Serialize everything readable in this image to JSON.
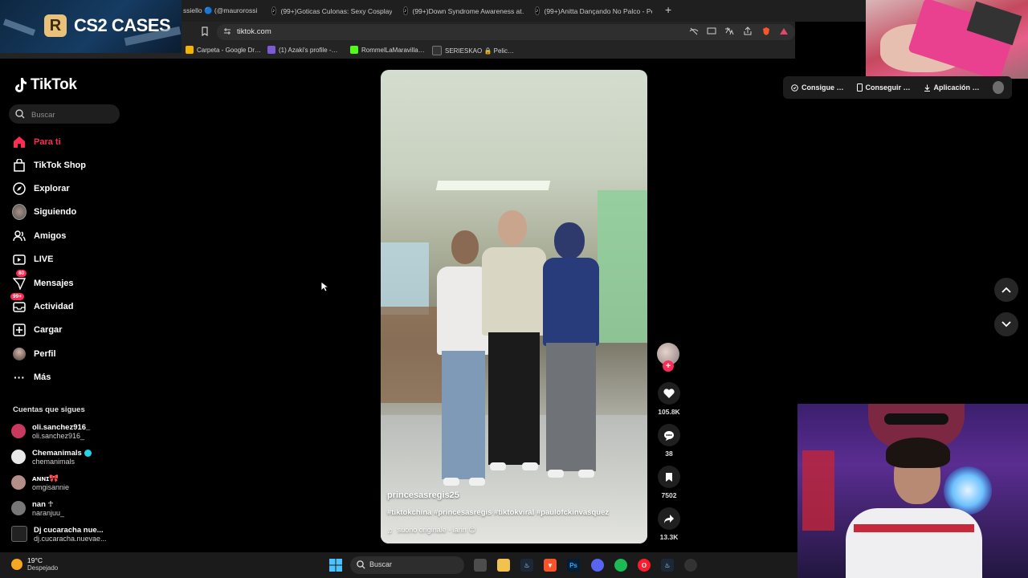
{
  "browser": {
    "tabs": [
      {
        "label": "ssiello 🔵 (@maurorossiell…"
      },
      {
        "label": "(99+)Goticas Culonas: Sexy Cosplay"
      },
      {
        "label": "(99+)Down Syndrome Awareness at…"
      },
      {
        "label": "(99+)Anitta Dançando No Palco - Pe"
      }
    ],
    "new_tab": "+",
    "url": "tiktok.com",
    "bookmarks": [
      {
        "label": "Carpeta - Google Dr…",
        "color": "#f4b400"
      },
      {
        "label": "(1) Azaki's profile -…",
        "color": "#7b5cd6"
      },
      {
        "label": "RommelLaMaravilla…",
        "color": "#53fc18"
      },
      {
        "label": "SERIESKAO 🔒 Pelic…",
        "color": "#333333"
      }
    ]
  },
  "overlay": {
    "cs2_logo": "R",
    "cs2_label": "CS2 CASES"
  },
  "sidebar": {
    "brand": "TikTok",
    "search_placeholder": "Buscar",
    "nav": [
      {
        "label": "Para ti",
        "icon": "home-icon",
        "active": true
      },
      {
        "label": "TikTok Shop",
        "icon": "shop-icon"
      },
      {
        "label": "Explorar",
        "icon": "compass-icon"
      },
      {
        "label": "Siguiendo",
        "icon": "following-avatar-icon"
      },
      {
        "label": "Amigos",
        "icon": "friends-icon"
      },
      {
        "label": "LIVE",
        "icon": "live-icon"
      },
      {
        "label": "Mensajes",
        "icon": "messages-icon",
        "badge": "80"
      },
      {
        "label": "Actividad",
        "icon": "activity-icon",
        "badge": "99+"
      },
      {
        "label": "Cargar",
        "icon": "upload-icon"
      },
      {
        "label": "Perfil",
        "icon": "profile-avatar-icon"
      },
      {
        "label": "Más",
        "icon": "more-icon"
      }
    ],
    "following_title": "Cuentas que sigues",
    "following": [
      {
        "name": "oli.sanchez916_",
        "handle": "oli.sanchez916_",
        "color": "#c9385e"
      },
      {
        "name": "Chemanimals",
        "handle": "chemanimals",
        "verified": true,
        "color": "#e8e8e8"
      },
      {
        "name": "ᴀɴɴɪ🎀",
        "handle": "omgisannie",
        "color": "#b48f8a"
      },
      {
        "name": "nan ☥",
        "handle": "naranjuu_",
        "color": "#777777"
      },
      {
        "name": "Dj cucaracha nue...",
        "handle": "dj.cucaracha.nuevae...",
        "color": "#222222"
      }
    ]
  },
  "video": {
    "username": "princesasregis25",
    "hashtags": "#tiktokchina #princesasregis #tiktokviral #paulofckinvasquez",
    "sound": "suono originale - iarin 😊"
  },
  "actions": {
    "likes": "105.8K",
    "comments": "38",
    "saves": "7502",
    "shares": "13.3K"
  },
  "topbar": {
    "coins": "Consigue …",
    "app": "Conseguir …",
    "download": "Aplicación …"
  },
  "taskbar": {
    "temp": "19°C",
    "weather": "Despejado",
    "search": "Buscar"
  }
}
